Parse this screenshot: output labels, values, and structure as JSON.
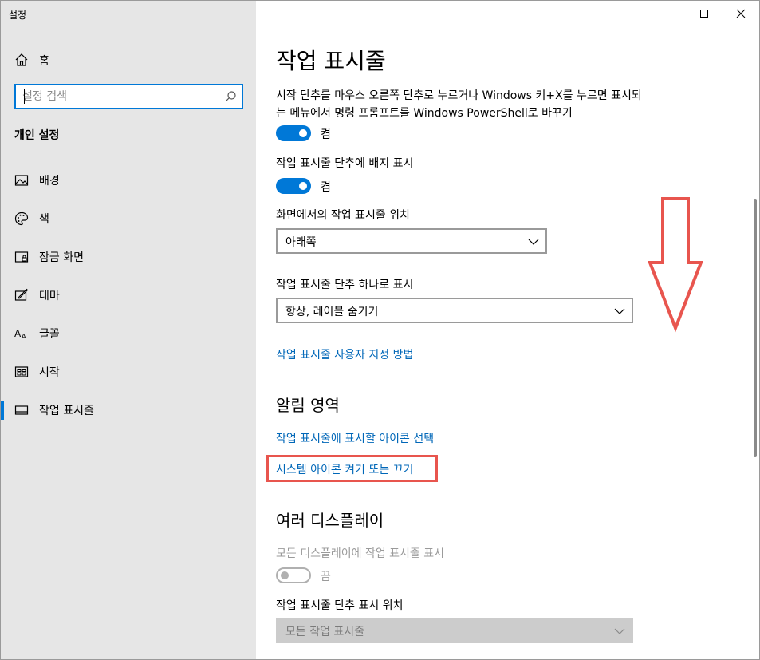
{
  "window": {
    "app_title": "설정"
  },
  "sidebar": {
    "home": {
      "label": "홈",
      "icon": "home-icon"
    },
    "search": {
      "placeholder": "설정 검색",
      "icon": "search-icon"
    },
    "section_heading": "개인 설정",
    "items": [
      {
        "label": "배경",
        "icon": "picture-icon",
        "active": false
      },
      {
        "label": "색",
        "icon": "palette-icon",
        "active": false
      },
      {
        "label": "잠금 화면",
        "icon": "lock-screen-icon",
        "active": false
      },
      {
        "label": "테마",
        "icon": "theme-icon",
        "active": false
      },
      {
        "label": "글꼴",
        "icon": "font-icon",
        "active": false
      },
      {
        "label": "시작",
        "icon": "start-icon",
        "active": false
      },
      {
        "label": "작업 표시줄",
        "icon": "taskbar-icon",
        "active": true
      }
    ],
    "accent_color": "#0078d7"
  },
  "main": {
    "title": "작업 표시줄",
    "powershell_setting": {
      "description": "시작 단추를 마우스 오른쪽 단추로 누르거나 Windows 키+X를 누르면 표시되는 메뉴에서 명령 프롬프트를 Windows PowerShell로 바꾸기",
      "toggle_state": "켬",
      "on": true
    },
    "badge_setting": {
      "label": "작업 표시줄 단추에 배지 표시",
      "toggle_state": "켬",
      "on": true
    },
    "location_setting": {
      "label": "화면에서의 작업 표시줄 위치",
      "selected": "아래쪽"
    },
    "combine_setting": {
      "label": "작업 표시줄 단추 하나로 표시",
      "selected": "항상, 레이블 숨기기"
    },
    "customize_link": "작업 표시줄 사용자 지정 방법",
    "notification_area": {
      "heading": "알림 영역",
      "link1": "작업 표시줄에 표시할 아이콘 선택",
      "link2": "시스템 아이콘 켜기 또는 끄기"
    },
    "multiple_displays": {
      "heading": "여러 디스플레이",
      "show_all_label": "모든 디스플레이에 작업 표시줄 표시",
      "toggle_state": "끔",
      "on": false,
      "buttons_label": "작업 표시줄 단추 표시 위치",
      "buttons_selected": "모든 작업 표시줄"
    },
    "link_color": "#0067b8",
    "annotation_color": "#e8554e"
  }
}
